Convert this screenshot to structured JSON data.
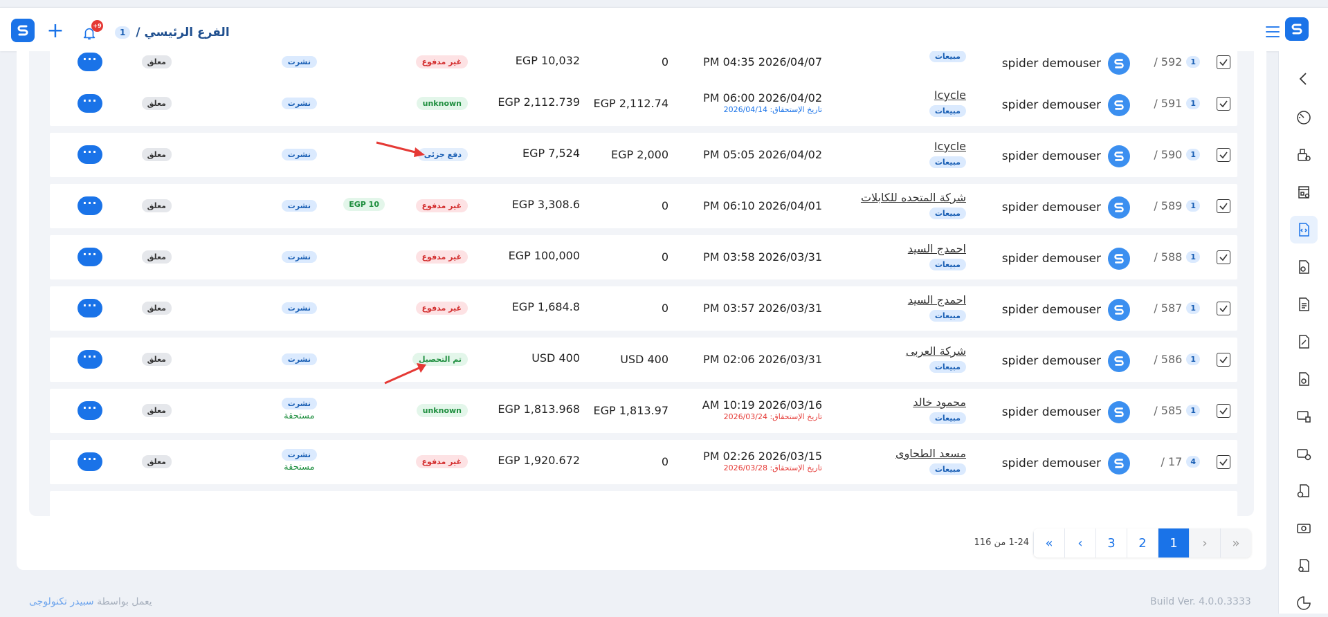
{
  "header": {
    "branch_name": "الفرع الرئيسي /",
    "branch_count": "1",
    "notification_badge": "+9"
  },
  "rows": [
    {
      "num": "592 /",
      "badge": "1",
      "user": "spider demouser",
      "customer": "",
      "tag": "مبيعات",
      "date": "PM 04:35 2026/04/07",
      "due": "",
      "due_color": "",
      "paid": "0",
      "total": "EGP 10,032",
      "status": "غير مدفوع",
      "status_type": "unpaid",
      "credit": "",
      "pub": "نشرت",
      "pub_due": "",
      "locked": "معلق"
    },
    {
      "num": "591 /",
      "badge": "1",
      "user": "spider demouser",
      "customer": "Icycle",
      "tag": "مبيعات",
      "date": "PM 06:00 2026/04/02",
      "due": "تاريخ الإستحقاق: 2026/04/14",
      "due_color": "blue",
      "paid": "EGP 2,112.74",
      "total": "EGP 2,112.739",
      "status": "unknown",
      "status_type": "unknown",
      "credit": "",
      "pub": "نشرت",
      "pub_due": "",
      "locked": "معلق"
    },
    {
      "num": "590 /",
      "badge": "1",
      "user": "spider demouser",
      "customer": "Icycle",
      "tag": "مبيعات",
      "date": "PM 05:05 2026/04/02",
      "due": "",
      "due_color": "",
      "paid": "EGP 2,000",
      "total": "EGP 7,524",
      "status": "دفع جزئى",
      "status_type": "partial",
      "credit": "",
      "pub": "نشرت",
      "pub_due": "",
      "locked": "معلق"
    },
    {
      "num": "589 /",
      "badge": "1",
      "user": "spider demouser",
      "customer": "شركة المتحده للكابلات",
      "tag": "مبيعات",
      "date": "PM 06:10 2026/04/01",
      "due": "",
      "due_color": "",
      "paid": "0",
      "total": "EGP 3,308.6",
      "status": "غير مدفوع",
      "status_type": "unpaid",
      "credit": "EGP 10",
      "pub": "نشرت",
      "pub_due": "",
      "locked": "معلق"
    },
    {
      "num": "588 /",
      "badge": "1",
      "user": "spider demouser",
      "customer": "احمدج السيد",
      "tag": "مبيعات",
      "date": "PM 03:58 2026/03/31",
      "due": "",
      "due_color": "",
      "paid": "0",
      "total": "EGP 100,000",
      "status": "غير مدفوع",
      "status_type": "unpaid",
      "credit": "",
      "pub": "نشرت",
      "pub_due": "",
      "locked": "معلق"
    },
    {
      "num": "587 /",
      "badge": "1",
      "user": "spider demouser",
      "customer": "احمدج السيد",
      "tag": "مبيعات",
      "date": "PM 03:57 2026/03/31",
      "due": "",
      "due_color": "",
      "paid": "0",
      "total": "EGP 1,684.8",
      "status": "غير مدفوع",
      "status_type": "unpaid",
      "credit": "",
      "pub": "نشرت",
      "pub_due": "",
      "locked": "معلق"
    },
    {
      "num": "586 /",
      "badge": "1",
      "user": "spider demouser",
      "customer": "شركة العربى",
      "tag": "مبيعات",
      "date": "PM 02:06 2026/03/31",
      "due": "",
      "due_color": "",
      "paid": "USD 400",
      "total": "USD 400",
      "status": "تم التحصيل",
      "status_type": "collected",
      "credit": "",
      "pub": "نشرت",
      "pub_due": "",
      "locked": "معلق"
    },
    {
      "num": "585 /",
      "badge": "1",
      "user": "spider demouser",
      "customer": "محمود خالد",
      "tag": "مبيعات",
      "date": "AM 10:19 2026/03/16",
      "due": "تاريخ الإستحقاق: 2026/03/24",
      "due_color": "red",
      "paid": "EGP 1,813.97",
      "total": "EGP 1,813.968",
      "status": "unknown",
      "status_type": "unknown",
      "credit": "",
      "pub": "نشرت",
      "pub_due": "مستحقة",
      "locked": "معلق"
    },
    {
      "num": "17 /",
      "badge": "4",
      "user": "spider demouser",
      "customer": "مسعد الطحاوى",
      "tag": "مبيعات",
      "date": "PM 02:26 2026/03/15",
      "due": "تاريخ الإستحقاق: 2026/03/28",
      "due_color": "red",
      "paid": "0",
      "total": "EGP 1,920.672",
      "status": "غير مدفوع",
      "status_type": "unpaid",
      "credit": "",
      "pub": "نشرت",
      "pub_due": "مستحقة",
      "locked": "معلق"
    }
  ],
  "more_label": "···",
  "pagination": {
    "range_text": "1-24 من 116",
    "pages": [
      "3",
      "2",
      "1"
    ],
    "first": "«",
    "prev": "‹",
    "next": "›",
    "last": "»"
  },
  "footer": {
    "build": "Build Ver. 4.0.0.3333",
    "powered_prefix": "يعمل بواسطة",
    "powered_link": "سبيدر تكنولوجى"
  },
  "colors": {
    "accent": "#1a73e8",
    "arrow": "#e53935"
  }
}
